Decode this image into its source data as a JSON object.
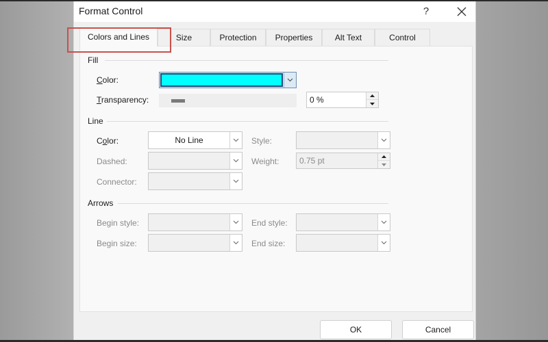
{
  "dialog": {
    "title": "Format Control",
    "help_label": "?",
    "close_icon": "close-icon"
  },
  "tabs": [
    {
      "label": "Colors and Lines",
      "active": true
    },
    {
      "label": "Size",
      "active": false
    },
    {
      "label": "Protection",
      "active": false
    },
    {
      "label": "Properties",
      "active": false
    },
    {
      "label": "Alt Text",
      "active": false
    },
    {
      "label": "Control",
      "active": false
    }
  ],
  "highlight_color": "#c9504a",
  "fill": {
    "group_label": "Fill",
    "color_label_prefix": "",
    "color_label_ul": "C",
    "color_label_rest": "olor:",
    "color_value": "#00ffff",
    "transparency_label_ul": "T",
    "transparency_label_rest": "ransparency:",
    "transparency_value": "0 %",
    "transparency_fraction": 0
  },
  "line": {
    "group_label": "Line",
    "color_label_pre": "C",
    "color_label_ul": "o",
    "color_label_rest": "lor:",
    "color_value": "No Line",
    "style_label": "Style:",
    "style_value": "",
    "dashed_label": "Dashed:",
    "dashed_value": "",
    "weight_label": "Weight:",
    "weight_value": "0.75 pt",
    "connector_label": "Connector:",
    "connector_value": ""
  },
  "arrows": {
    "group_label": "Arrows",
    "begin_style_label": "Begin style:",
    "begin_style_value": "",
    "end_style_label": "End style:",
    "end_style_value": "",
    "begin_size_label": "Begin size:",
    "begin_size_value": "",
    "end_size_label": "End size:",
    "end_size_value": ""
  },
  "footer": {
    "ok_label": "OK",
    "cancel_label": "Cancel"
  }
}
